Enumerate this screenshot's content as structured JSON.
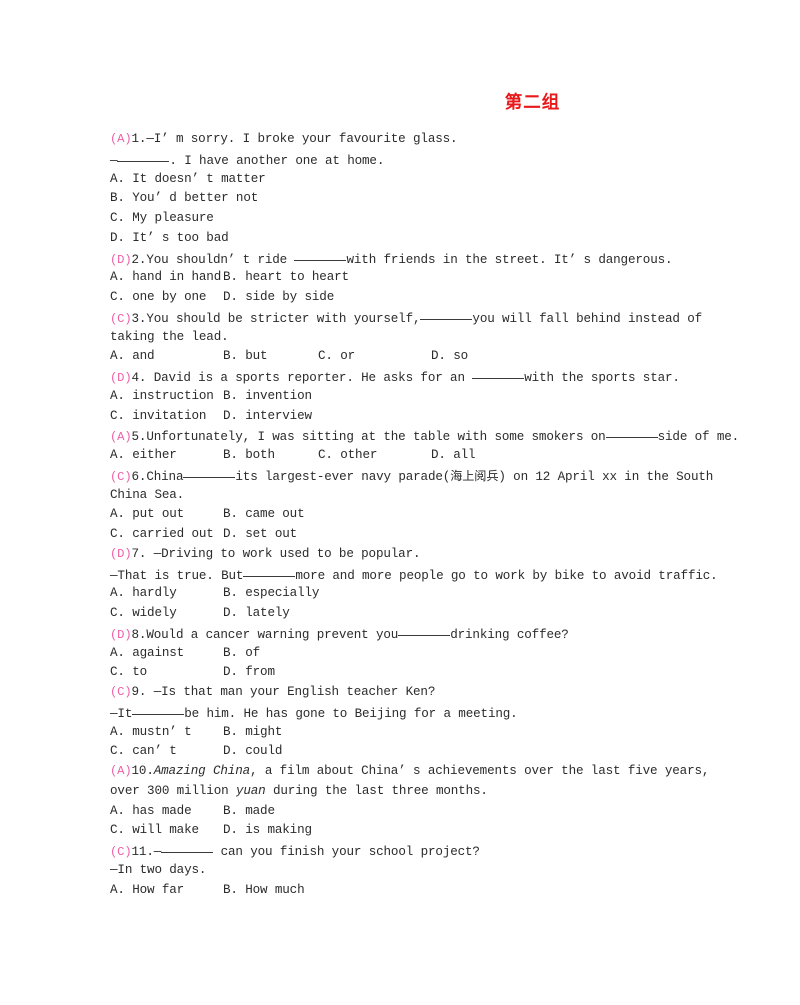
{
  "document": {
    "title": "第二组",
    "title_color": "#e8191b",
    "answer_color": "#ee5fa7"
  },
  "questions": [
    {
      "answer": "(A)",
      "number": "1.",
      "stem_lines": [
        {
          "pre": "—I’ m sorry. I broke your favourite glass.",
          "blank": false
        },
        {
          "pre": "—",
          "blank": true,
          "post": ". I have another one at home."
        }
      ],
      "options_layout": "stacked",
      "options": [
        "A. It doesn’ t matter",
        "B. You’ d better not",
        "C. My pleasure",
        "D. It’ s too bad"
      ]
    },
    {
      "answer": "(D)",
      "number": "2.",
      "stem_lines": [
        {
          "pre": "You shouldn’ t ride ",
          "blank": true,
          "post": "with friends in the street. It’ s dangerous."
        }
      ],
      "options_layout": "two",
      "options": [
        "A. hand in hand",
        "B. heart to heart",
        "C. one by one",
        "D. side by side"
      ]
    },
    {
      "answer": "(C)",
      "number": "3.",
      "stem_lines": [
        {
          "pre": "You should be stricter with yourself,",
          "blank": true,
          "post": "you will fall behind instead of"
        },
        {
          "pre": "taking the lead.",
          "blank": false
        }
      ],
      "options_layout": "four",
      "options": [
        "A. and",
        "B. but",
        "C. or",
        "D. so"
      ]
    },
    {
      "answer": "(D)",
      "number": "4.",
      "stem_lines": [
        {
          "pre": " David is a sports reporter. He asks for an ",
          "blank": true,
          "post": "with the sports star."
        }
      ],
      "options_layout": "two",
      "options": [
        "A. instruction",
        "B. invention",
        "C. invitation",
        "D. interview"
      ]
    },
    {
      "answer": "(A)",
      "number": "5.",
      "stem_lines": [
        {
          "pre": "Unfortunately, I was sitting at the table with some smokers on",
          "blank": true,
          "post": "side of me."
        }
      ],
      "options_layout": "four",
      "options": [
        "A. either",
        "B. both",
        "C. other",
        "D. all"
      ]
    },
    {
      "answer": "(C)",
      "number": "6.",
      "stem_lines": [
        {
          "pre": "China",
          "blank": true,
          "post": "its largest-ever navy parade(海上阅兵) on 12 April xx in the South"
        },
        {
          "pre": "China Sea.",
          "blank": false
        }
      ],
      "options_layout": "two",
      "options": [
        "A. put out",
        "B. came out",
        "C. carried out",
        "D. set out"
      ]
    },
    {
      "answer": "(D)",
      "number": "7.",
      "stem_lines": [
        {
          "pre": " —Driving to work used to be popular.",
          "blank": false
        },
        {
          "pre": "—That is true. But",
          "blank": true,
          "post": "more and more people go to work by bike to avoid traffic."
        }
      ],
      "options_layout": "two",
      "options": [
        "A. hardly",
        "B. especially",
        "C. widely",
        "D. lately"
      ]
    },
    {
      "answer": "(D)",
      "number": "8.",
      "stem_lines": [
        {
          "pre": "Would a cancer warning prevent you",
          "blank": true,
          "post": "drinking coffee?"
        }
      ],
      "options_layout": "two",
      "options": [
        "A. against",
        "B. of",
        "C. to",
        "D. from"
      ]
    },
    {
      "answer": "(C)",
      "number": "9.",
      "stem_lines": [
        {
          "pre": " —Is that man your English teacher Ken?",
          "blank": false
        },
        {
          "pre": "—It",
          "blank": true,
          "post": "be him. He has gone to Beijing for a meeting."
        }
      ],
      "options_layout": "two",
      "options": [
        "A. mustn’ t",
        "B. might",
        "C. can’ t",
        "D. could"
      ]
    },
    {
      "answer": "(A)",
      "number": "10.",
      "stem_lines": [
        {
          "pre": "",
          "italic": "Amazing China",
          "post": ", a film about China’ s achievements over the last five years,",
          "blank": false
        },
        {
          "pre": "over 300 million ",
          "italic": "yuan",
          "post": " during the last three months.",
          "blank": false
        }
      ],
      "options_layout": "two",
      "options": [
        "A. has made",
        "B. made",
        "C. will make",
        "D. is making"
      ]
    },
    {
      "answer": "(C)",
      "number": "11.",
      "stem_lines": [
        {
          "pre": "—",
          "blank": true,
          "post": " can you finish your school project?"
        },
        {
          "pre": "—In two days.",
          "blank": false
        }
      ],
      "options_layout": "two",
      "options": [
        "A. How far",
        "B. How much"
      ]
    }
  ]
}
